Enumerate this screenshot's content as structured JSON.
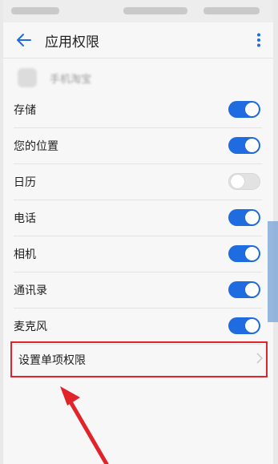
{
  "header": {
    "title": "应用权限"
  },
  "app": {
    "name": "手机淘宝"
  },
  "permissions": [
    {
      "label": "存储",
      "enabled": true
    },
    {
      "label": "您的位置",
      "enabled": true
    },
    {
      "label": "日历",
      "enabled": false
    },
    {
      "label": "电话",
      "enabled": true
    },
    {
      "label": "相机",
      "enabled": true
    },
    {
      "label": "通讯录",
      "enabled": true
    },
    {
      "label": "麦克风",
      "enabled": true
    }
  ],
  "single_permission": {
    "label": "设置单项权限"
  },
  "colors": {
    "accent": "#1e6cdf",
    "highlight": "#e0242a"
  },
  "icons": {
    "back": "arrow-left-icon",
    "more": "more-vertical-icon",
    "chevron": "chevron-right-icon"
  }
}
